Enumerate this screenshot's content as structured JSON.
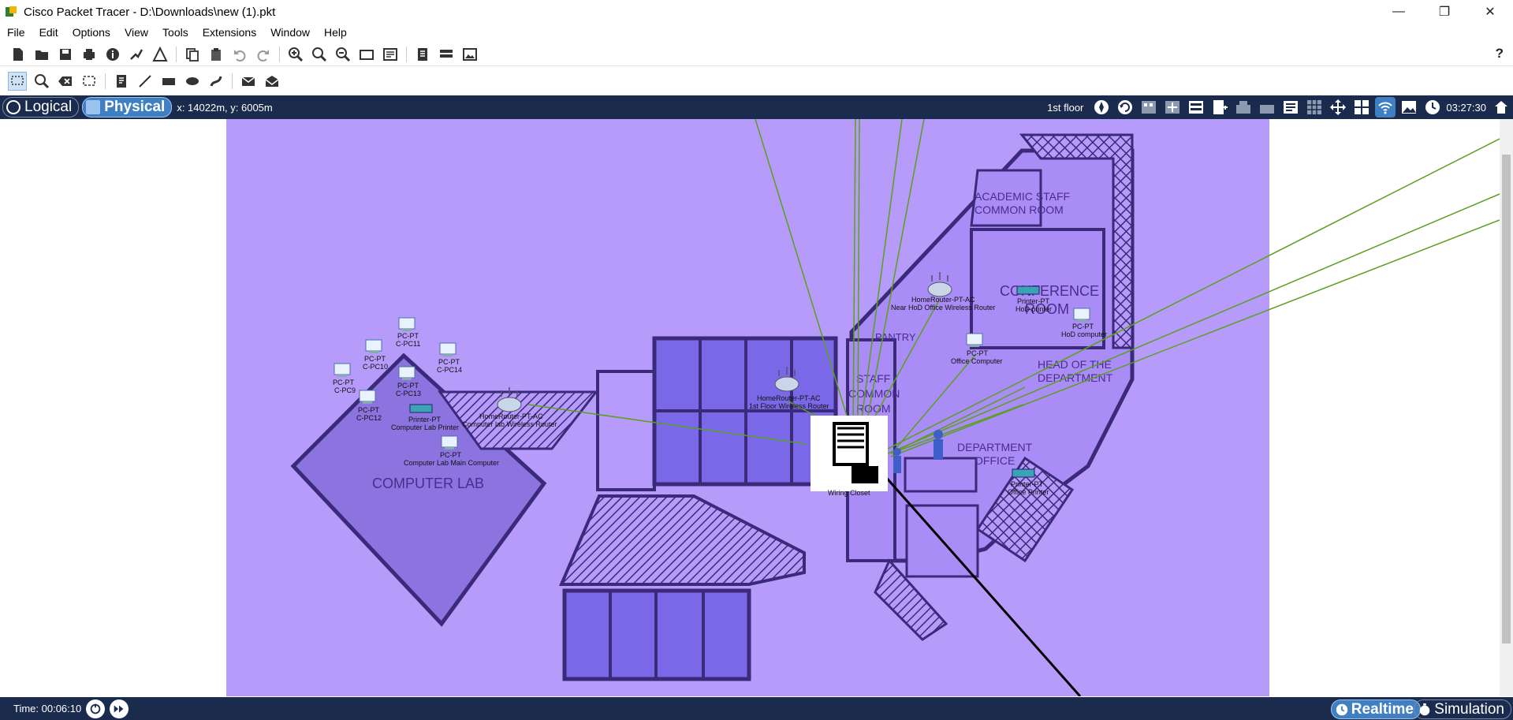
{
  "window": {
    "title": "Cisco Packet Tracer - D:\\Downloads\\new (1).pkt",
    "minimize": "—",
    "restore": "❐",
    "close": "✕"
  },
  "menu": [
    "File",
    "Edit",
    "Options",
    "View",
    "Tools",
    "Extensions",
    "Window",
    "Help"
  ],
  "help_label": "?",
  "navbar": {
    "logical_label": "Logical",
    "physical_label": "Physical",
    "coords": "x: 14022m, y: 6005m",
    "floor": "1st floor",
    "clock": "03:27:30"
  },
  "floorplan": {
    "rooms": {
      "academic": "ACADEMIC STAFF",
      "academic2": "COMMON ROOM",
      "conference": "CONFERENCE",
      "conference2": "ROOM",
      "pantry": "PANTRY",
      "staff": "STAFF",
      "staff2": "COMMON",
      "staff3": "ROOM",
      "hod": "HEAD OF THE",
      "hod2": "DEPARTMENT",
      "dept": "DEPARTMENT",
      "dept2": "OFFICE",
      "lab": "COMPUTER LAB"
    },
    "devices": {
      "pc11_type": "PC-PT",
      "pc11_name": "C-PC11",
      "pc10_type": "PC-PT",
      "pc10_name": "C-PC10",
      "pc14_type": "PC-PT",
      "pc14_name": "C-PC14",
      "pc9_type": "PC-PT",
      "pc9_name": "C-PC9",
      "pc13_type": "PC-PT",
      "pc13_name": "C-PC13",
      "pc12_type": "PC-PT",
      "pc12_name": "C-PC12",
      "labprinter_type": "Printer-PT",
      "labprinter_name": "Computer Lab Printer",
      "labrouter_type": "HomeRouter-PT-AC",
      "labrouter_name": "Computer lab Wireless Router",
      "labmain_type": "PC-PT",
      "labmain_name": "Computer Lab Main Computer",
      "floorrouter_type": "HomeRouter-PT-AC",
      "floorrouter_name": "1st Floor  Wireless Router",
      "hodrouter_type": "HomeRouter-PT-AC",
      "hodrouter_name": "Near HoD Office Wireless Router",
      "hodprinter_type": "Printer-PT",
      "hodprinter_name": "HoD printer",
      "hodpc_type": "PC-PT",
      "hodpc_name": "HoD computer",
      "officepc_type": "PC-PT",
      "officepc_name": "Office Computer",
      "officeprinter_type": "Printer-PT",
      "officeprinter_name": "Office Printer",
      "closet_name": "Wiring Closet"
    }
  },
  "statusbar": {
    "time": "Time: 00:06:10",
    "realtime_label": "Realtime",
    "simulation_label": "Simulation"
  },
  "colors": {
    "navbar_bg": "#1a2b4e",
    "canvas_bg": "#b69bfb",
    "link_green": "#5aa01e",
    "accent_blue": "#3f7fc2"
  }
}
